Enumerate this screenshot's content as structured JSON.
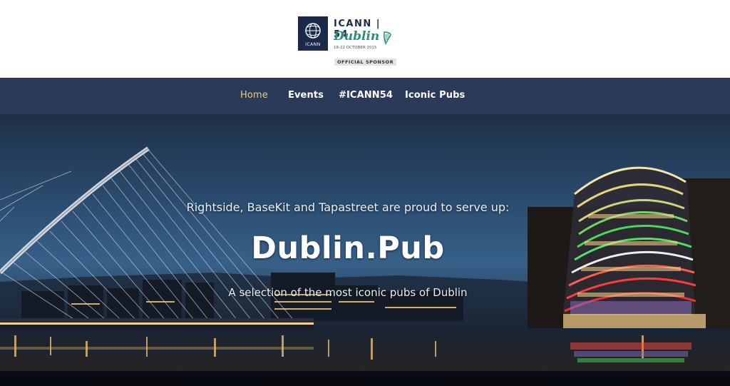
{
  "header": {
    "logo": {
      "box_label": "ICANN",
      "title": "ICANN | 54",
      "city": "Dublin",
      "dates": "18-22 OCTOBER 2015",
      "sponsor": "OFFICIAL SPONSOR",
      "icons": [
        "globe-icon",
        "harp-icon"
      ]
    }
  },
  "nav": {
    "items": [
      {
        "label": "Home",
        "active": true
      },
      {
        "label": "Events",
        "active": false
      },
      {
        "label": "#ICANN54",
        "active": false
      },
      {
        "label": "Iconic Pubs",
        "active": false
      }
    ],
    "active_color": "#e8c98a",
    "background": "#2b3a58"
  },
  "hero": {
    "intro": "Rightside, BaseKit and Tapastreet are proud to serve up:",
    "title": "Dublin.Pub",
    "subtitle": "A selection of the most iconic pubs of Dublin"
  },
  "colors": {
    "brand_navy": "#1b2a4a",
    "brand_green": "#2a8f7c"
  }
}
